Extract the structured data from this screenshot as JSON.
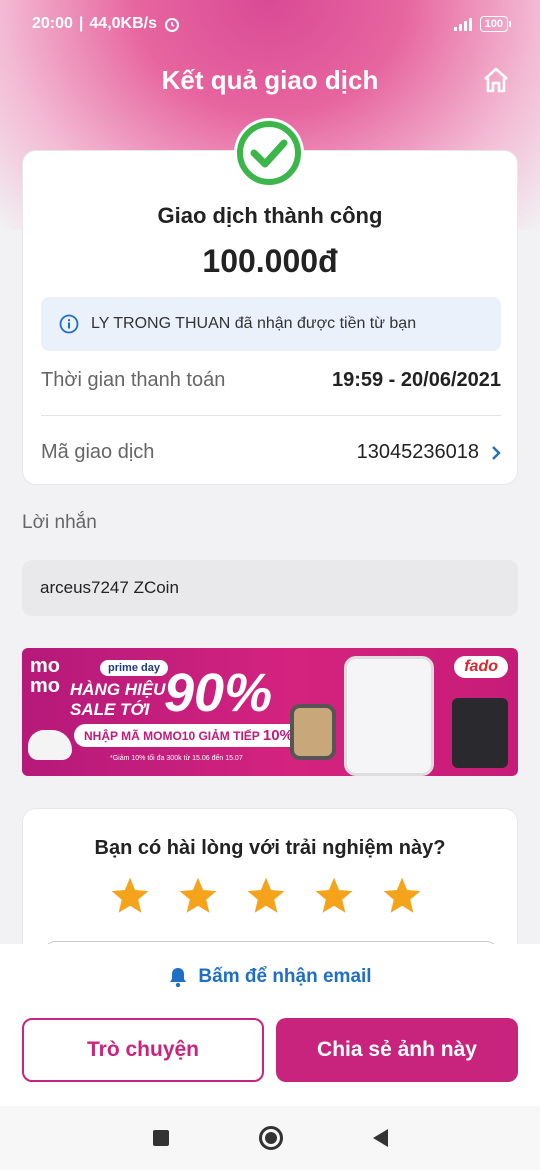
{
  "status_bar": {
    "time": "20:00",
    "speed": "44,0KB/s",
    "battery": "100"
  },
  "header": {
    "title": "Kết quả giao dịch",
    "home_icon": "home-icon"
  },
  "result": {
    "status": "Giao dịch thành công",
    "amount": "100.000đ",
    "info": "LY TRONG THUAN đã nhận được tiền từ bạn",
    "time_label": "Thời gian thanh toán",
    "time_value": "19:59 - 20/06/2021",
    "txn_label": "Mã giao dịch",
    "txn_value": "13045236018"
  },
  "message": {
    "label": "Lời nhắn",
    "text": "arceus7247 ZCoin"
  },
  "banner": {
    "momo": "mo mo",
    "prime": "prime day",
    "sale_line1": "HÀNG HIỆU",
    "sale_line2": "SALE TỚI",
    "big": "90%",
    "code_text": "NHẬP MÃ MOMO10 GIẢM TIẾP",
    "code_pct": "10%",
    "note": "*Giảm 10% tối đa 300k từ 15.06 đến 15.07",
    "fado": "fado"
  },
  "rating": {
    "question": "Bạn có hài lòng với trải nghiệm này?",
    "stars": 5,
    "star_color": "#f5a31a"
  },
  "actions": {
    "email": "Bấm để nhận email",
    "chat": "Trò chuyện",
    "share": "Chia sẻ ảnh này"
  },
  "colors": {
    "brand": "#c8247e",
    "link": "#1f6fc5",
    "success": "#3cb54a"
  }
}
